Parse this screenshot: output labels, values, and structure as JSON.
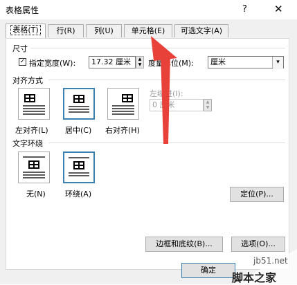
{
  "window": {
    "title": "表格属性",
    "help_label": "?",
    "close_label": "✕"
  },
  "tabs": [
    {
      "label": "表格(T)",
      "active": true
    },
    {
      "label": "行(R)"
    },
    {
      "label": "列(U)"
    },
    {
      "label": "单元格(E)"
    },
    {
      "label": "可选文字(A)"
    }
  ],
  "size": {
    "section_label": "尺寸",
    "preferred_width_checked": true,
    "preferred_width_label": "指定宽度(W):",
    "width_value": "17.32 厘米",
    "measure_label": "度量单位(M):",
    "measure_value": "厘米"
  },
  "alignment": {
    "section_label": "对齐方式",
    "options": [
      {
        "label": "左对齐(L)",
        "selected": false
      },
      {
        "label": "居中(C)",
        "selected": true
      },
      {
        "label": "右对齐(H)",
        "selected": false
      }
    ],
    "indent_label": "左缩进(I):",
    "indent_value": "0 厘米"
  },
  "wrapping": {
    "section_label": "文字环绕",
    "options": [
      {
        "label": "无(N)",
        "selected": false
      },
      {
        "label": "环绕(A)",
        "selected": true
      }
    ],
    "position_button": "定位(P)..."
  },
  "footer": {
    "borders_button": "边框和底纹(B)...",
    "options_button": "选项(O)...",
    "ok_button": "确定"
  },
  "watermark": {
    "url": "jb51.net",
    "site": "脚本之家"
  },
  "colors": {
    "accent": "#3c7fb1",
    "arrow": "#e8413a"
  }
}
